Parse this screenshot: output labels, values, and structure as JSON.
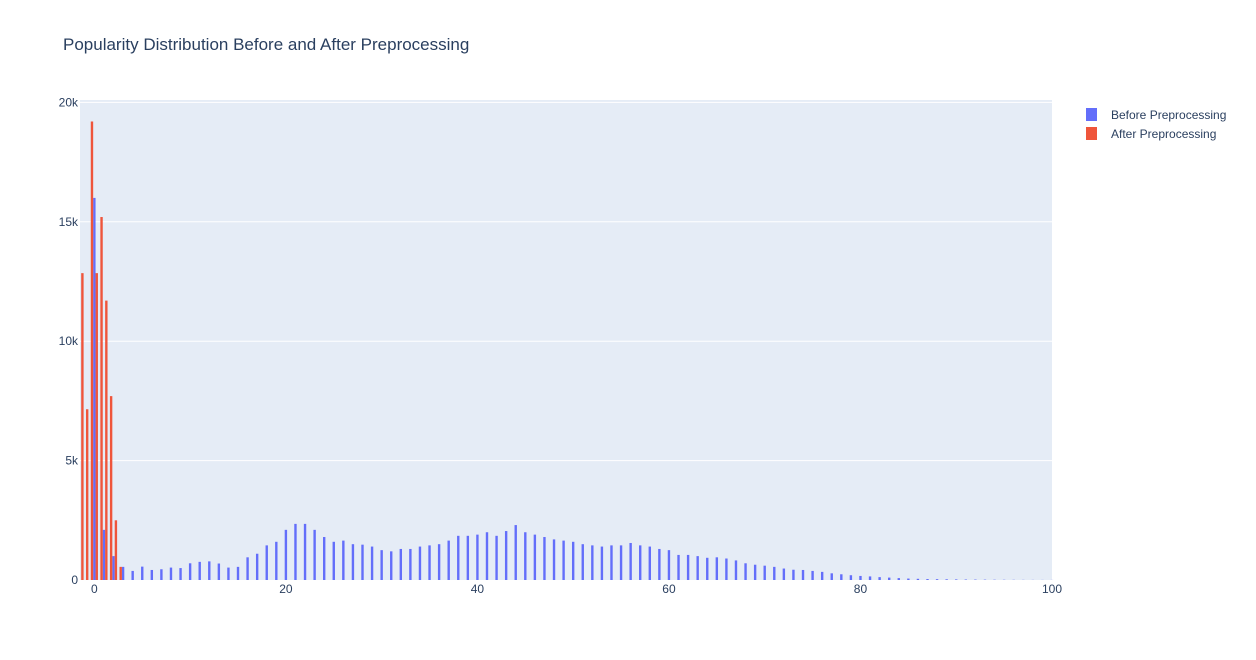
{
  "chart_data": {
    "type": "bar",
    "title": "Popularity Distribution Before and After Preprocessing",
    "xlabel": "",
    "ylabel": "",
    "xlim": [
      -1.5,
      100
    ],
    "ylim": [
      0,
      20100
    ],
    "x_ticks": [
      0,
      20,
      40,
      60,
      80,
      100
    ],
    "x_tick_labels": [
      "0",
      "20",
      "40",
      "60",
      "80",
      "100"
    ],
    "y_ticks": [
      0,
      5000,
      10000,
      15000,
      20000
    ],
    "y_tick_labels": [
      "0",
      "5k",
      "10k",
      "15k",
      "20k"
    ],
    "grid": true,
    "legend_position": "top-right",
    "plot_background": "#e5ecf6",
    "series": [
      {
        "name": "Before Preprocessing",
        "color": "#636efa",
        "x": [
          0,
          1,
          2,
          3,
          4,
          5,
          6,
          7,
          8,
          9,
          10,
          11,
          12,
          13,
          14,
          15,
          16,
          17,
          18,
          19,
          20,
          21,
          22,
          23,
          24,
          25,
          26,
          27,
          28,
          29,
          30,
          31,
          32,
          33,
          34,
          35,
          36,
          37,
          38,
          39,
          40,
          41,
          42,
          43,
          44,
          45,
          46,
          47,
          48,
          49,
          50,
          51,
          52,
          53,
          54,
          55,
          56,
          57,
          58,
          59,
          60,
          61,
          62,
          63,
          64,
          65,
          66,
          67,
          68,
          69,
          70,
          71,
          72,
          73,
          74,
          75,
          76,
          77,
          78,
          79,
          80,
          81,
          82,
          83,
          84,
          85,
          86,
          87,
          88,
          89,
          90,
          91,
          92,
          93,
          94,
          95,
          96,
          97,
          98,
          99,
          100
        ],
        "values": [
          16000,
          2100,
          1000,
          550,
          380,
          560,
          420,
          450,
          520,
          500,
          700,
          760,
          780,
          690,
          520,
          550,
          950,
          1100,
          1450,
          1600,
          2100,
          2350,
          2350,
          2100,
          1800,
          1600,
          1650,
          1500,
          1480,
          1400,
          1250,
          1200,
          1300,
          1300,
          1400,
          1450,
          1500,
          1650,
          1850,
          1850,
          1900,
          2000,
          1850,
          2050,
          2300,
          2000,
          1900,
          1800,
          1700,
          1650,
          1600,
          1500,
          1450,
          1400,
          1450,
          1450,
          1550,
          1450,
          1400,
          1300,
          1250,
          1050,
          1050,
          1000,
          930,
          950,
          900,
          820,
          700,
          640,
          600,
          550,
          480,
          430,
          420,
          380,
          340,
          280,
          240,
          200,
          170,
          150,
          120,
          100,
          80,
          60,
          50,
          40,
          35,
          30,
          25,
          20,
          18,
          15,
          12,
          10,
          8,
          6,
          5,
          4,
          3
        ]
      },
      {
        "name": "After Preprocessing",
        "color": "#ef553b",
        "x": [
          -1.25,
          -0.75,
          -0.25,
          0.25,
          0.75,
          1.25,
          1.75,
          2.25,
          2.75
        ],
        "values": [
          12850,
          7150,
          19200,
          12850,
          15200,
          11700,
          7700,
          2500,
          550
        ]
      }
    ]
  }
}
